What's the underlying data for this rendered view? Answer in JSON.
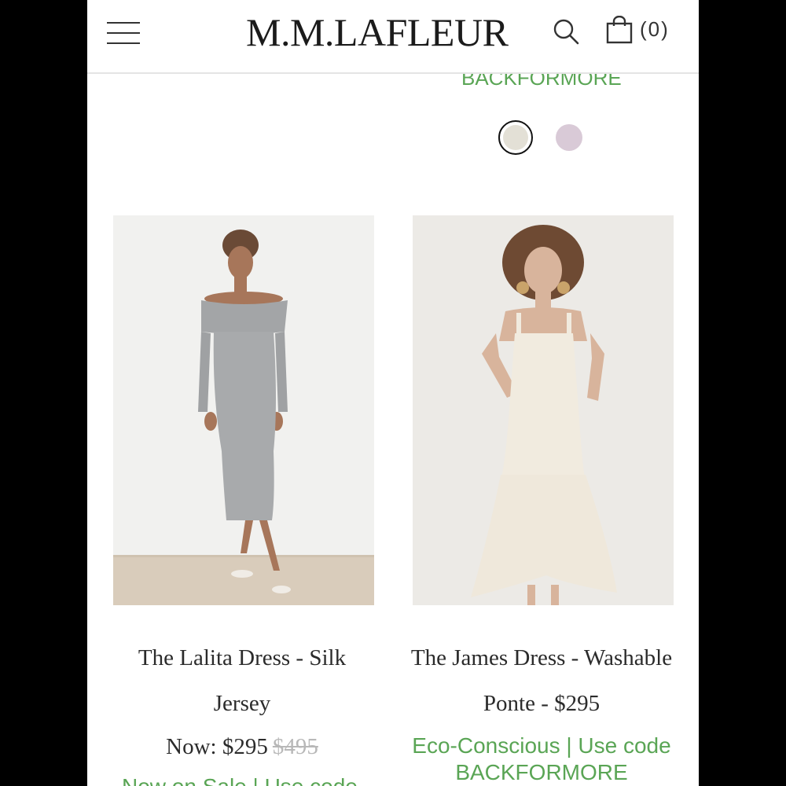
{
  "header": {
    "logo": "M.M.LAFLEUR",
    "bag_count": "(0)"
  },
  "promo_top": "BACKFORMORE",
  "swatches": [
    {
      "color": "#e3e0d6",
      "selected": true
    },
    {
      "color": "#d9cad7",
      "selected": false
    }
  ],
  "products": [
    {
      "title": "The Lalita Dress - Silk Jersey",
      "price_label": "Now: $295",
      "old_price": "$495",
      "promo_cut": "Now on Sale | Use code"
    },
    {
      "title": "The James Dress - Washable Ponte - $295",
      "promo": "Eco-Conscious | Use code BACKFORMORE"
    }
  ],
  "colors": {
    "accent_green": "#5aa555",
    "text": "#2b2b2b"
  },
  "icons": [
    "menu-icon",
    "search-icon",
    "shopping-bag-icon"
  ]
}
